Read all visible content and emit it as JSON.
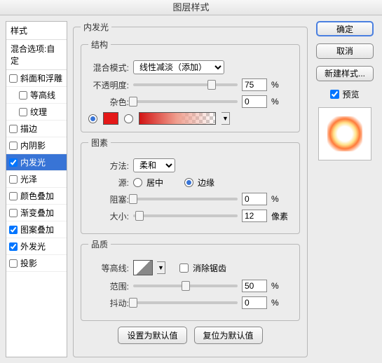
{
  "title": "图层样式",
  "sidebar": {
    "styles_label": "样式",
    "blend_opts_label": "混合选项:自定",
    "items": [
      {
        "label": "斜面和浮雕",
        "checked": false
      },
      {
        "label": "等高线",
        "checked": false,
        "sub": true
      },
      {
        "label": "纹理",
        "checked": false,
        "sub": true
      },
      {
        "label": "描边",
        "checked": false
      },
      {
        "label": "内阴影",
        "checked": false
      },
      {
        "label": "内发光",
        "checked": true,
        "selected": true
      },
      {
        "label": "光泽",
        "checked": false
      },
      {
        "label": "颜色叠加",
        "checked": false
      },
      {
        "label": "渐变叠加",
        "checked": false
      },
      {
        "label": "图案叠加",
        "checked": true
      },
      {
        "label": "外发光",
        "checked": true
      },
      {
        "label": "投影",
        "checked": false
      }
    ]
  },
  "panel": {
    "title": "内发光",
    "struct": {
      "legend": "结构",
      "blend_mode_label": "混合模式:",
      "blend_mode_value": "线性减淡（添加）",
      "opacity_label": "不透明度:",
      "opacity_value": "75",
      "percent": "%",
      "noise_label": "杂色:",
      "noise_value": "0"
    },
    "elements": {
      "legend": "图素",
      "method_label": "方法:",
      "method_value": "柔和",
      "source_label": "源:",
      "source_center": "居中",
      "source_edge": "边缘",
      "choke_label": "阻塞:",
      "choke_value": "0",
      "size_label": "大小:",
      "size_value": "12",
      "px": "像素"
    },
    "quality": {
      "legend": "品质",
      "contour_label": "等高线:",
      "antialias_label": "消除锯齿",
      "range_label": "范围:",
      "range_value": "50",
      "jitter_label": "抖动:",
      "jitter_value": "0"
    },
    "buttons": {
      "make_default": "设置为默认值",
      "reset_default": "复位为默认值"
    }
  },
  "right": {
    "ok": "确定",
    "cancel": "取消",
    "new_style": "新建样式...",
    "preview": "预览"
  }
}
